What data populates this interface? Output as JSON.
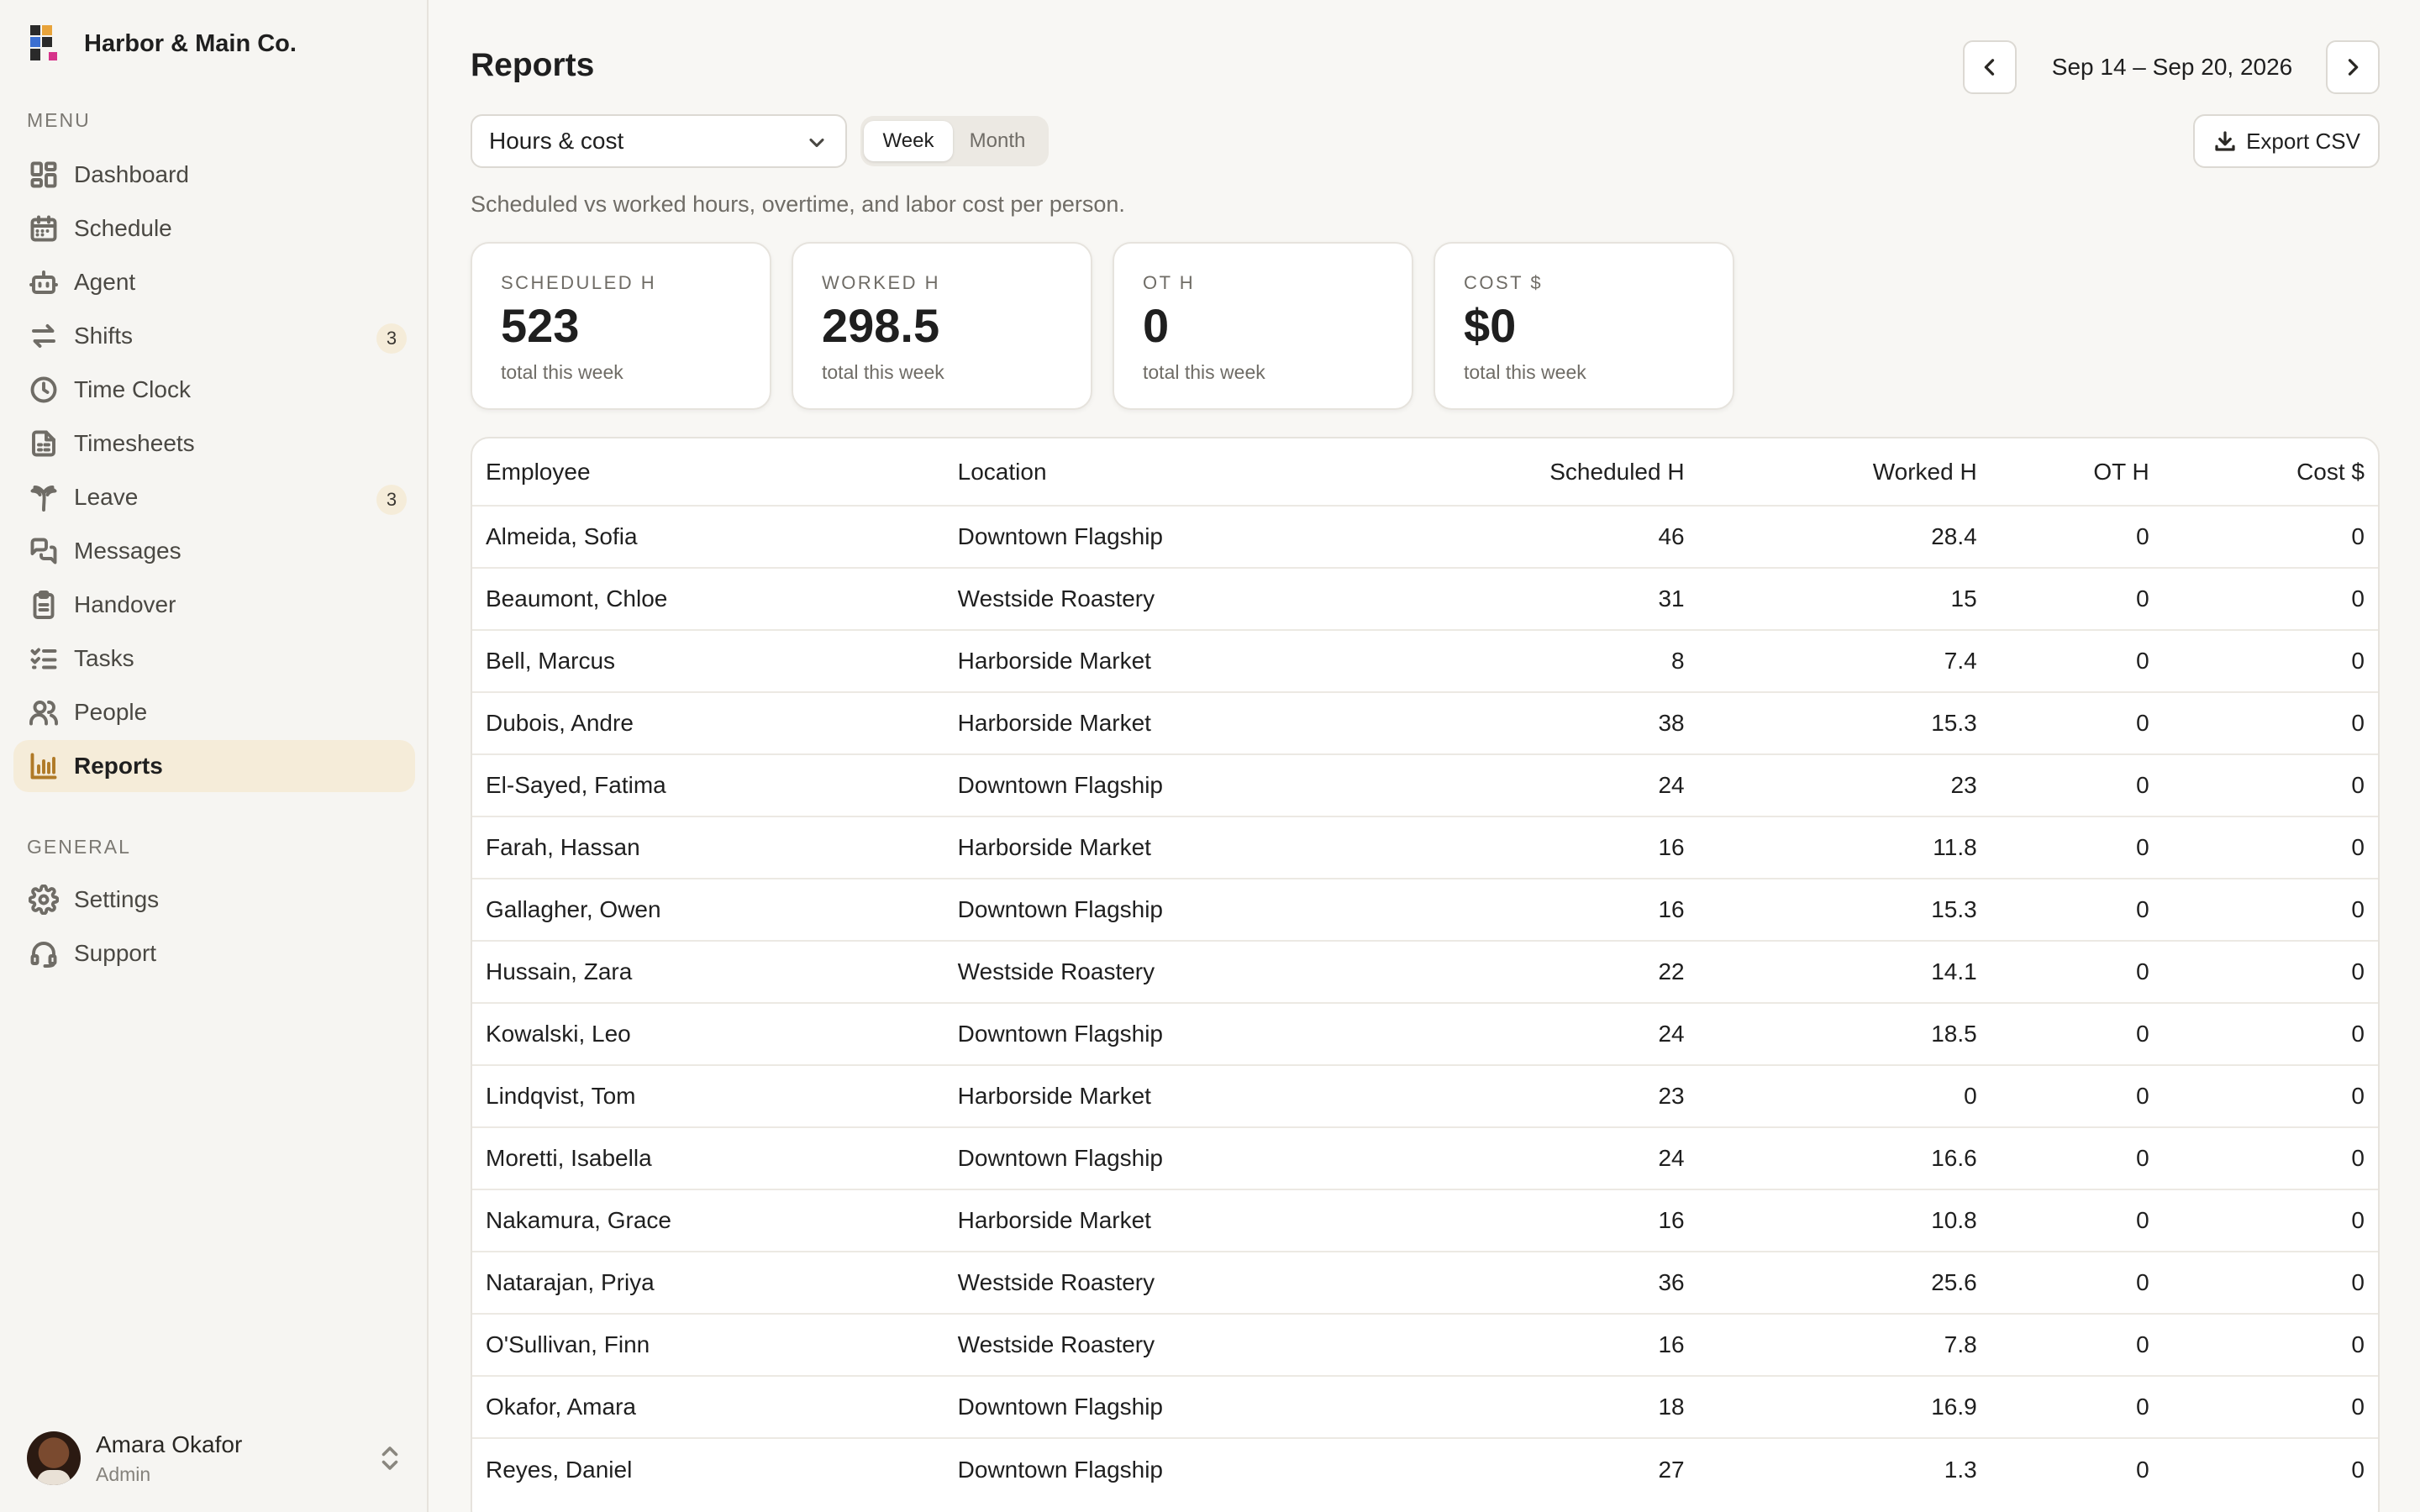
{
  "app": {
    "brand_name": "Harbor & Main Co.",
    "accent_color": "#b07a27",
    "active_bg": "#f5ecd9"
  },
  "sidebar": {
    "menu_label": "MENU",
    "general_label": "GENERAL",
    "items": [
      {
        "key": "dashboard",
        "label": "Dashboard",
        "icon": "dashboard-icon"
      },
      {
        "key": "schedule",
        "label": "Schedule",
        "icon": "calendar-icon"
      },
      {
        "key": "agent",
        "label": "Agent",
        "icon": "bot-icon"
      },
      {
        "key": "shifts",
        "label": "Shifts",
        "icon": "swap-icon",
        "badge": "3"
      },
      {
        "key": "time-clock",
        "label": "Time Clock",
        "icon": "clock-icon"
      },
      {
        "key": "timesheets",
        "label": "Timesheets",
        "icon": "file-icon"
      },
      {
        "key": "leave",
        "label": "Leave",
        "icon": "palm-tree-icon",
        "badge": "3"
      },
      {
        "key": "messages",
        "label": "Messages",
        "icon": "messages-icon"
      },
      {
        "key": "handover",
        "label": "Handover",
        "icon": "clipboard-icon"
      },
      {
        "key": "tasks",
        "label": "Tasks",
        "icon": "list-checks-icon"
      },
      {
        "key": "people",
        "label": "People",
        "icon": "users-icon"
      },
      {
        "key": "reports",
        "label": "Reports",
        "icon": "bar-chart-icon",
        "active": true
      }
    ],
    "general_items": [
      {
        "key": "settings",
        "label": "Settings",
        "icon": "gear-icon"
      },
      {
        "key": "support",
        "label": "Support",
        "icon": "headset-icon"
      }
    ],
    "user": {
      "name": "Amara Okafor",
      "role": "Admin"
    }
  },
  "header": {
    "title": "Reports",
    "date_range": "Sep 14 – Sep 20, 2026"
  },
  "controls": {
    "report_type": "Hours & cost",
    "period_options": [
      "Week",
      "Month"
    ],
    "period_selected": "Week",
    "export_label": "Export CSV"
  },
  "description": "Scheduled vs worked hours, overtime, and labor cost per person.",
  "stats": [
    {
      "label": "SCHEDULED H",
      "value": "523",
      "sub": "total this week"
    },
    {
      "label": "WORKED H",
      "value": "298.5",
      "sub": "total this week"
    },
    {
      "label": "OT H",
      "value": "0",
      "sub": "total this week"
    },
    {
      "label": "COST $",
      "value": "$0",
      "sub": "total this week"
    }
  ],
  "table": {
    "columns": [
      "Employee",
      "Location",
      "Scheduled H",
      "Worked H",
      "OT H",
      "Cost $"
    ],
    "rows": [
      [
        "Almeida, Sofia",
        "Downtown Flagship",
        "46",
        "28.4",
        "0",
        "0"
      ],
      [
        "Beaumont, Chloe",
        "Westside Roastery",
        "31",
        "15",
        "0",
        "0"
      ],
      [
        "Bell, Marcus",
        "Harborside Market",
        "8",
        "7.4",
        "0",
        "0"
      ],
      [
        "Dubois, Andre",
        "Harborside Market",
        "38",
        "15.3",
        "0",
        "0"
      ],
      [
        "El-Sayed, Fatima",
        "Downtown Flagship",
        "24",
        "23",
        "0",
        "0"
      ],
      [
        "Farah, Hassan",
        "Harborside Market",
        "16",
        "11.8",
        "0",
        "0"
      ],
      [
        "Gallagher, Owen",
        "Downtown Flagship",
        "16",
        "15.3",
        "0",
        "0"
      ],
      [
        "Hussain, Zara",
        "Westside Roastery",
        "22",
        "14.1",
        "0",
        "0"
      ],
      [
        "Kowalski, Leo",
        "Downtown Flagship",
        "24",
        "18.5",
        "0",
        "0"
      ],
      [
        "Lindqvist, Tom",
        "Harborside Market",
        "23",
        "0",
        "0",
        "0"
      ],
      [
        "Moretti, Isabella",
        "Downtown Flagship",
        "24",
        "16.6",
        "0",
        "0"
      ],
      [
        "Nakamura, Grace",
        "Harborside Market",
        "16",
        "10.8",
        "0",
        "0"
      ],
      [
        "Natarajan, Priya",
        "Westside Roastery",
        "36",
        "25.6",
        "0",
        "0"
      ],
      [
        "O'Sullivan, Finn",
        "Westside Roastery",
        "16",
        "7.8",
        "0",
        "0"
      ],
      [
        "Okafor, Amara",
        "Downtown Flagship",
        "18",
        "16.9",
        "0",
        "0"
      ],
      [
        "Reyes, Daniel",
        "Downtown Flagship",
        "27",
        "1.3",
        "0",
        "0"
      ]
    ]
  }
}
